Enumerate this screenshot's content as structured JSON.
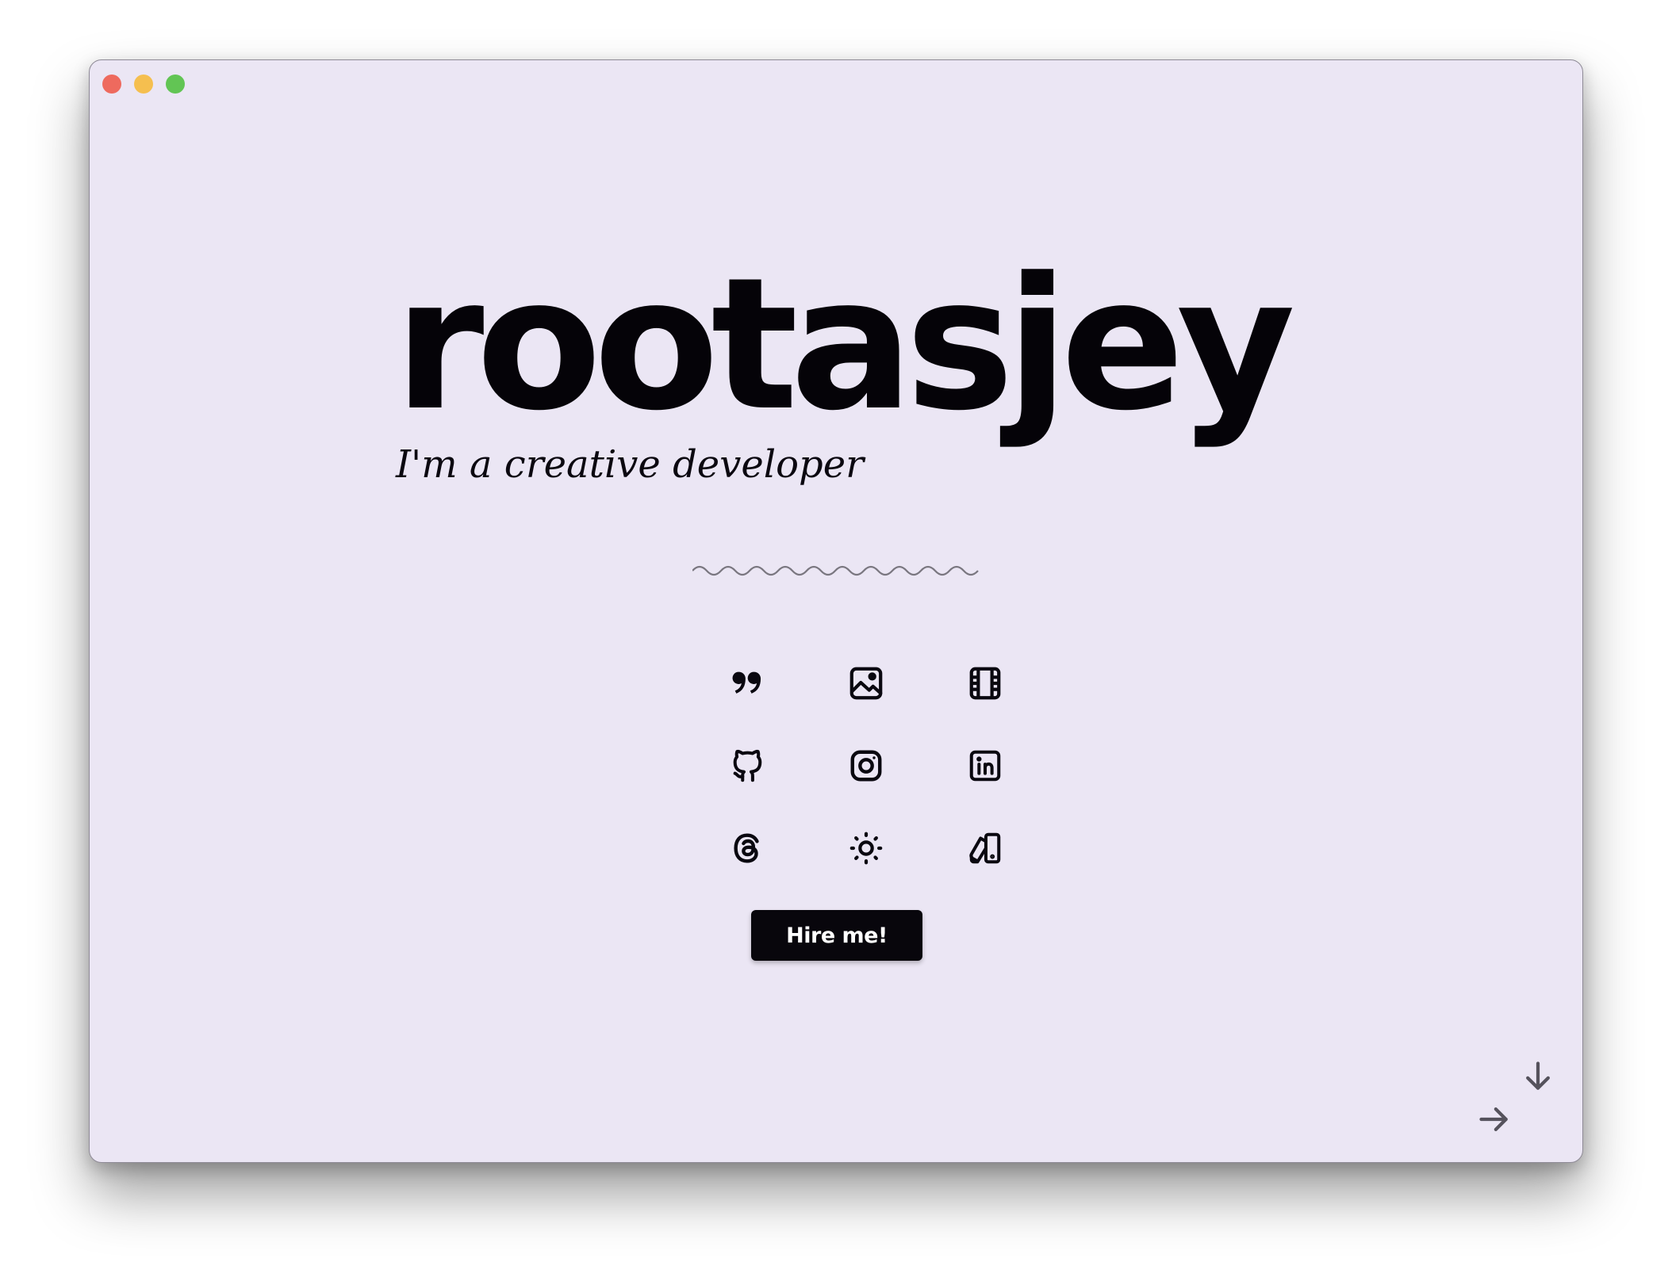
{
  "window": {
    "controls": [
      "close",
      "minimize",
      "maximize"
    ],
    "colors": {
      "background": "#ebe6f4",
      "close": "#ee6a5e",
      "minimize": "#f5bf4f",
      "maximize": "#62c554"
    }
  },
  "hero": {
    "title": "rootasjey",
    "tagline": "I'm a creative developer"
  },
  "icons": [
    {
      "name": "quote-icon"
    },
    {
      "name": "image-icon"
    },
    {
      "name": "film-icon"
    },
    {
      "name": "github-icon"
    },
    {
      "name": "instagram-icon"
    },
    {
      "name": "linkedin-icon"
    },
    {
      "name": "threads-icon"
    },
    {
      "name": "sun-icon"
    },
    {
      "name": "design-swatch-icon"
    }
  ],
  "cta": {
    "label": "Hire me!",
    "background": "#08060c",
    "color": "#ffffff"
  },
  "navigation": {
    "down": "arrow-down-icon",
    "right": "arrow-right-icon"
  }
}
